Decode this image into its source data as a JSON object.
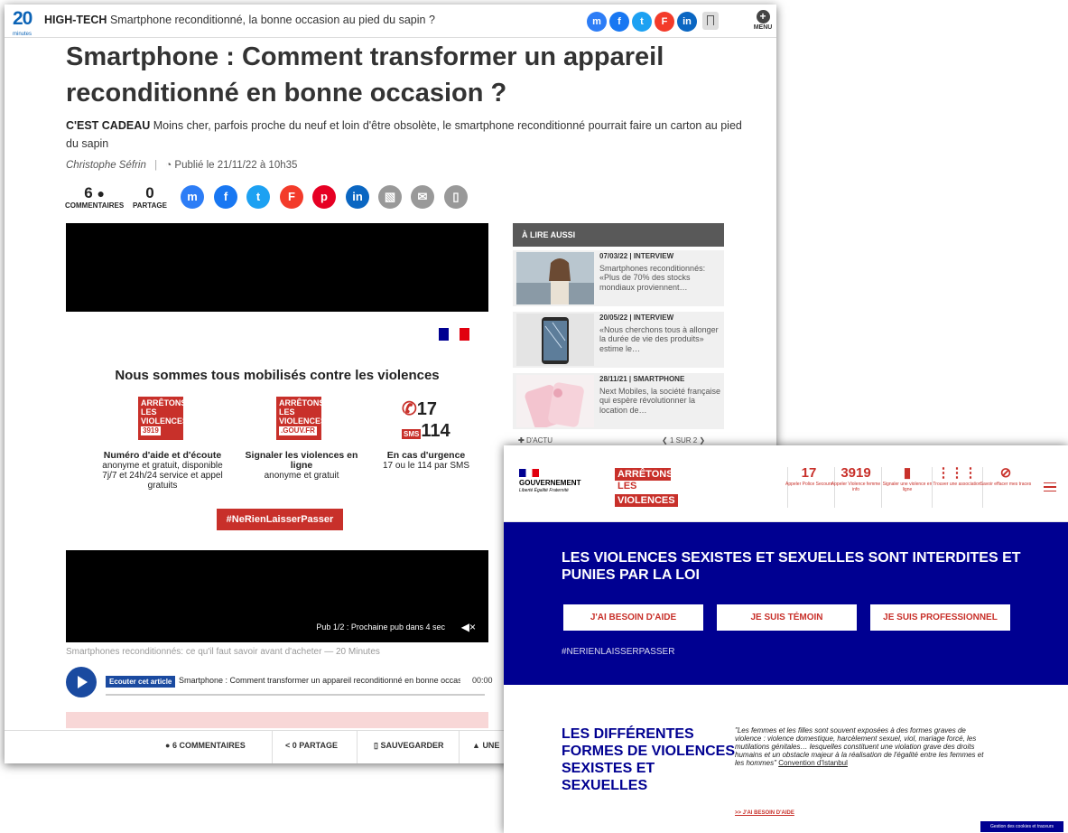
{
  "article_window": {
    "header": {
      "logo": "20",
      "logo_sub": "minutes",
      "section": "HIGH-TECH",
      "headline": "Smartphone reconditionné, la bonne occasion au pied du sapin ?",
      "menu_label": "MENU"
    },
    "title": "Smartphone : Comment transformer un appareil reconditionné en bonne occasion ?",
    "kicker": "C'EST CADEAU",
    "intro": "Moins cher, parfois proche du neuf et loin d'être obsolète, le smartphone reconditionné pourrait faire un carton au pied du sapin",
    "author": "Christophe Séfrin",
    "published": "Publié le 21/11/22 à 10h35",
    "comments_count": "6",
    "comments_label": "COMMENTAIRES",
    "shares_count": "0",
    "shares_label": "PARTAGE",
    "ad": {
      "title": "Nous sommes tous mobilisés contre les violences",
      "col1_title": "Numéro d'aide et d'écoute",
      "col1_text": "anonyme et gratuit, disponible 7j/7 et 24h/24 service et appel gratuits",
      "col2_title": "Signaler les violences en ligne",
      "col2_text": "anonyme et gratuit",
      "col3_title": "En cas d'urgence",
      "col3_text": "17 ou le 114 par SMS",
      "badge1_line1": "ARRÊTONS",
      "badge1_line2": "LES",
      "badge1_line3": "VIOLENCES",
      "badge1_num": "3919",
      "badge2_line1": "ARRÊTONS",
      "badge2_line2": "LES",
      "badge2_line3": "VIOLENCES",
      "badge2_num": ".GOUV.FR",
      "num17": "17",
      "num114": "114",
      "hashtag_button": "#NeRienLaisserPasser"
    },
    "video_pub": "Pub 1/2 : Prochaine pub dans 4 sec",
    "caption": "Smartphones reconditionnés: ce qu'il faut savoir avant d'acheter — 20 Minutes",
    "player": {
      "listen_label": "Ecouter cet article",
      "track_title": "Smartphone : Comment transformer un appareil reconditionné en bonne occasion ?",
      "time": "00:00"
    },
    "sidebar": {
      "heading": "À LIRE AUSSI",
      "items": [
        {
          "meta": "07/03/22 | INTERVIEW",
          "text": "Smartphones reconditionnés: «Plus de 70% des stocks mondiaux proviennent…"
        },
        {
          "meta": "20/05/22 | INTERVIEW",
          "text": "«Nous cherchons tous à allonger la durée de vie des produits» estime le…"
        },
        {
          "meta": "28/11/21 | SMARTPHONE",
          "text": "Next Mobiles, la société française qui espère révolutionner la location de…"
        }
      ],
      "more_label": "D'ACTU",
      "pager": "1 SUR 2"
    },
    "footer": {
      "comments": "6 COMMENTAIRES",
      "share": "0 PARTAGE",
      "save": "SAUVEGARDER",
      "report": "UNE"
    }
  },
  "gov_window": {
    "gov_label": "GOUVERNEMENT",
    "motto": "Liberté Égalité Fraternité",
    "brand_line1": "ARRÊTONS",
    "brand_line2": "LES",
    "brand_line3": "VIOLENCES",
    "nav": [
      {
        "big": "17",
        "label": "Appeler Police Secours"
      },
      {
        "big": "3919",
        "label": "Appeler Violence femme info"
      },
      {
        "big": "",
        "label": "Signaler une violence en ligne"
      },
      {
        "big": "",
        "label": "Trouver une association"
      },
      {
        "big": "",
        "label": "Savoir effacer mes traces"
      }
    ],
    "hero_title": "LES VIOLENCES SEXISTES ET SEXUELLES SONT INTERDITES ET PUNIES PAR LA LOI",
    "buttons": [
      "J'AI BESOIN D'AIDE",
      "JE SUIS TÉMOIN",
      "JE SUIS PROFESSIONNEL"
    ],
    "hashtag": "#NERIENLAISSERPASSER",
    "section_title": "LES DIFFÉRENTES FORMES DE VIOLENCES SEXISTES ET SEXUELLES",
    "quote": "\"Les femmes et les filles sont souvent exposées à des formes graves de violence : violence domestique, harcèlement sexuel, viol, mariage forcé, les mutilations génitales… lesquelles constituent une violation grave des droits humains et un obstacle majeur à la réalisation de l'égalité entre les femmes et les hommes\"",
    "quote_source": "Convention d'Istanbul",
    "aide_link": ">> J'AI BESOIN D'AIDE",
    "cookie": "Gestion des cookies et traceurs"
  },
  "colors": {
    "brand_blue": "#0b63b6",
    "gov_blue": "#000091",
    "alert_red": "#c8302a"
  }
}
